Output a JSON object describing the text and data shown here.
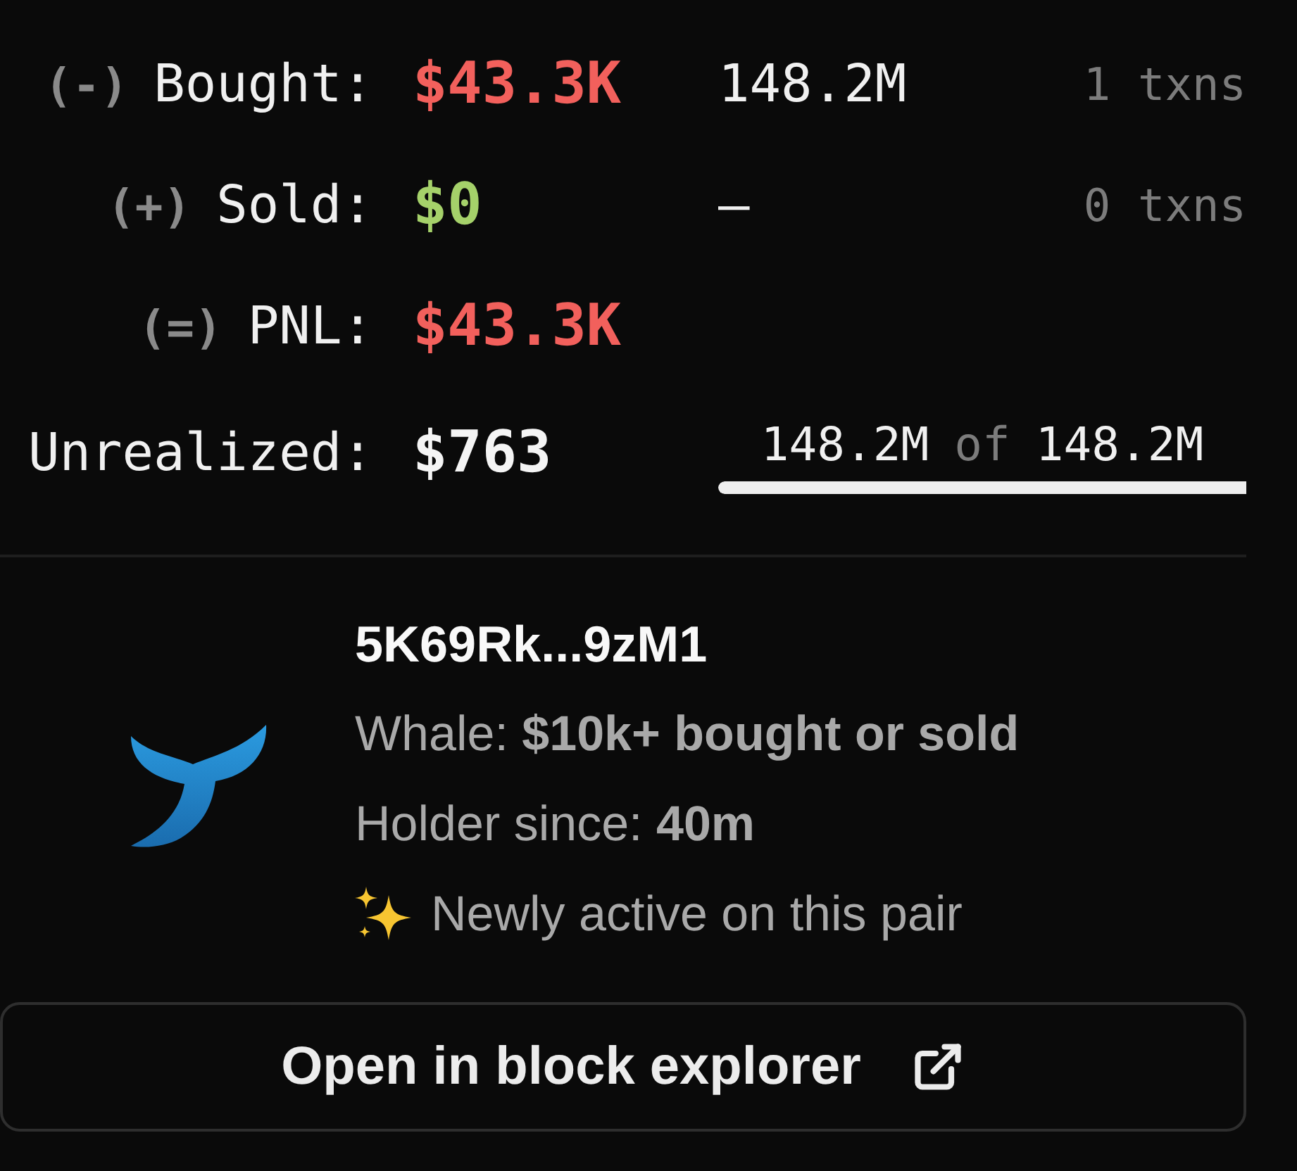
{
  "pnl_rows": [
    {
      "sign": "(-)",
      "label": "Bought:",
      "value": "$43.3K",
      "color": "#f2605c",
      "amount": "148.2M",
      "txns": "1 txns"
    },
    {
      "sign": "(+)",
      "label": "Sold:",
      "value": "$0",
      "color": "#a5d16a",
      "amount": "–",
      "txns": "0 txns"
    },
    {
      "sign": "(=)",
      "label": "PNL:",
      "value": "$43.3K",
      "color": "#f2605c"
    }
  ],
  "unrealized": {
    "label": "Unrealized:",
    "value": "$763",
    "held": "148.2M",
    "of": "of",
    "total": "148.2M",
    "level": 1
  },
  "wallet": {
    "address": "5K69Rk...9zM1",
    "details": [
      {
        "kind": "text",
        "text": "Whale: **$10k+ bought or sold**"
      },
      {
        "kind": "text",
        "text": "Holder since: **40m**"
      },
      {
        "kind": "sparkle",
        "text": "Newly active on this pair"
      }
    ]
  },
  "button": {
    "label": "Open in block explorer"
  }
}
